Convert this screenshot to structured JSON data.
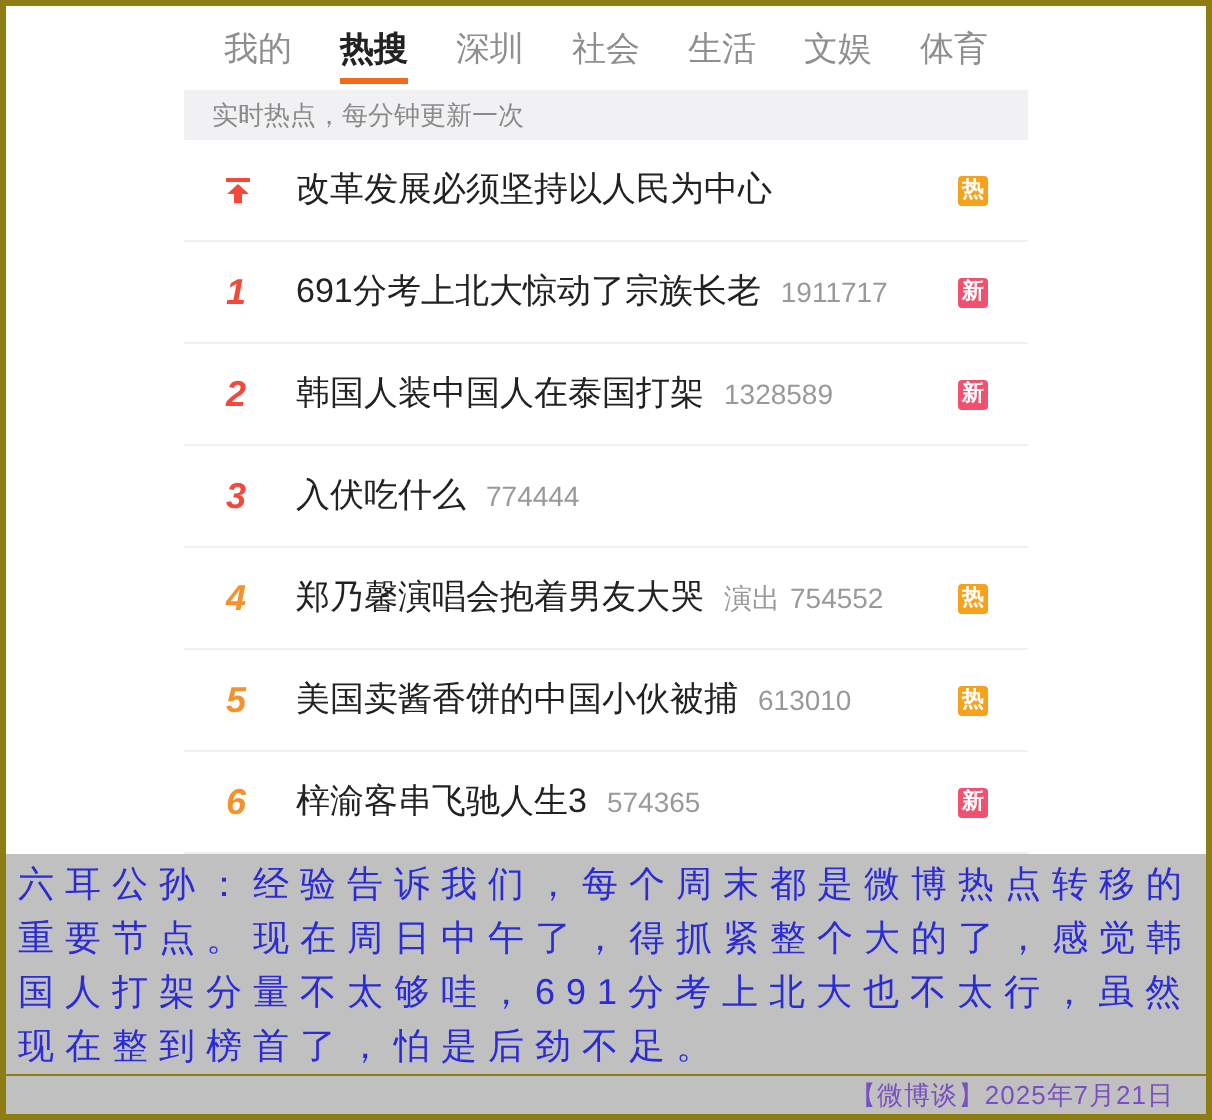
{
  "tabs": [
    {
      "label": "我的",
      "selected": false
    },
    {
      "label": "热搜",
      "selected": true
    },
    {
      "label": "深圳",
      "selected": false
    },
    {
      "label": "社会",
      "selected": false
    },
    {
      "label": "生活",
      "selected": false
    },
    {
      "label": "文娱",
      "selected": false
    },
    {
      "label": "体育",
      "selected": false
    }
  ],
  "notice": "实时热点，每分钟更新一次",
  "items": [
    {
      "kind": "pinned",
      "color": "#f5483a",
      "title": "改革发展必须坚持以人民为中心",
      "badge": {
        "kind": "hot",
        "text": "热"
      }
    },
    {
      "kind": "ranked",
      "rank": "1",
      "color": "#f5483a",
      "title": "691分考上北大惊动了宗族长老",
      "count": "1911717",
      "badge": {
        "kind": "new",
        "text": "新"
      }
    },
    {
      "kind": "ranked",
      "rank": "2",
      "color": "#f5483a",
      "title": "韩国人装中国人在泰国打架",
      "count": "1328589",
      "badge": {
        "kind": "new",
        "text": "新"
      }
    },
    {
      "kind": "ranked",
      "rank": "3",
      "color": "#f5483a",
      "title": "入伏吃什么",
      "count": "774444"
    },
    {
      "kind": "ranked",
      "rank": "4",
      "color": "#f7922a",
      "title": "郑乃馨演唱会抱着男友大哭",
      "category": "演出",
      "count": "754552",
      "badge": {
        "kind": "hot",
        "text": "热"
      }
    },
    {
      "kind": "ranked",
      "rank": "5",
      "color": "#f7922a",
      "title": "美国卖酱香饼的中国小伙被捕",
      "count": "613010",
      "badge": {
        "kind": "hot",
        "text": "热"
      }
    },
    {
      "kind": "ranked",
      "rank": "6",
      "color": "#f7922a",
      "title": "梓渝客串飞驰人生3",
      "count": "574365",
      "badge": {
        "kind": "new",
        "text": "新"
      }
    }
  ],
  "comment": "六耳公孙：经验告诉我们，每个周末都是微博热点转移的重要节点。现在周日中午了，得抓紧整个大的了，感觉韩国人打架分量不太够哇，691分考上北大也不太行，虽然现在整到榜首了，怕是后劲不足。",
  "footer": "【微博谈】2025年7月21日"
}
